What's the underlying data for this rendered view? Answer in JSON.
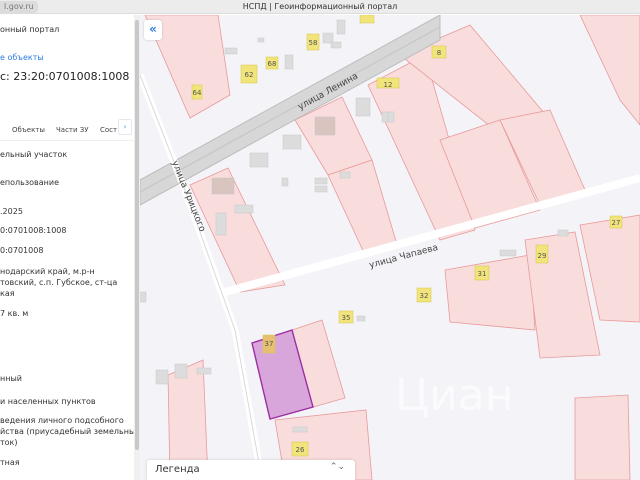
{
  "browser": {
    "url": "l.gov.ru",
    "title": "НСПД | Геоинформационный портал"
  },
  "panel": {
    "portal": "онный портал",
    "link": "е объекты",
    "cadastral_title": "с: 23:20:0701008:1008",
    "tabs": [
      "Объекты",
      "Части ЗУ",
      "Сост"
    ],
    "tab_next": "›",
    "fields": [
      "ельный участок",
      "епользование",
      ".2025",
      "0:0701008:1008",
      "0:0701008",
      "нодарский край, м.р-н",
      "товский, с.п. Губское, ст-ца",
      "кая",
      "7 кв. м",
      "нный",
      "и населенных пунктов",
      "ведения личного подсобного",
      "йства (приусадебный земельный",
      "ток)",
      "тная"
    ]
  },
  "map": {
    "collapse_icon": "«",
    "streets": {
      "lenina": "улица Ленина",
      "chapaeva": "улица Чапаева",
      "uritskogo": "улица Урицкого"
    },
    "house_numbers": [
      "64",
      "62",
      "68",
      "58",
      "12",
      "8",
      "27",
      "29",
      "31",
      "32",
      "35",
      "37",
      "26"
    ],
    "watermark": "Циан",
    "selected_color": "#d9a6dc",
    "parcel_color": "#f9dcdc"
  },
  "legend": {
    "title": "Легенда",
    "toggle": "⌃⌄"
  }
}
